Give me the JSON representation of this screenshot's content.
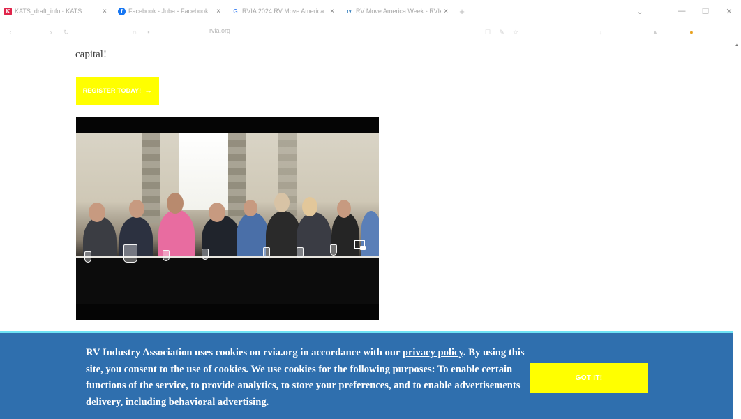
{
  "browser": {
    "tabs": [
      {
        "title": "KATS_draft_info - KATS",
        "favicon": "K",
        "favicon_color": "#e0244a",
        "close": "×"
      },
      {
        "title": "Facebook - Juba - Facebook",
        "favicon": "f",
        "favicon_color": "#1877f2",
        "close": "×"
      },
      {
        "title": "RVIA 2024 RV Move America",
        "favicon": "G",
        "favicon_color": "#4285f4",
        "close": "×"
      },
      {
        "title": "RV Move America Week - RVIA",
        "favicon": "rv",
        "favicon_color": "#1b6fb5",
        "close": "×"
      }
    ],
    "new_tab": "+",
    "url": "rvia.org"
  },
  "page": {
    "text_fragment": "capital!",
    "register_button": "REGISTER TODAY!",
    "register_arrow": "→"
  },
  "video": {
    "pip_icon": "picture-in-picture-icon"
  },
  "cookie_banner": {
    "text_before_link": "RV Industry Association uses cookies on rvia.org in accordance with our ",
    "link_text": "privacy policy",
    "text_after_link": ". By using this site, you consent to the use of cookies. We use cookies for the following purposes: To enable certain functions of the service, to provide analytics, to store your preferences, and to enable advertisements delivery, including behavioral advertising.",
    "button_label": "GOT IT!"
  },
  "colors": {
    "accent_yellow": "#ffff00",
    "banner_blue": "#2f6fae",
    "banner_border": "#6fe3f5"
  }
}
